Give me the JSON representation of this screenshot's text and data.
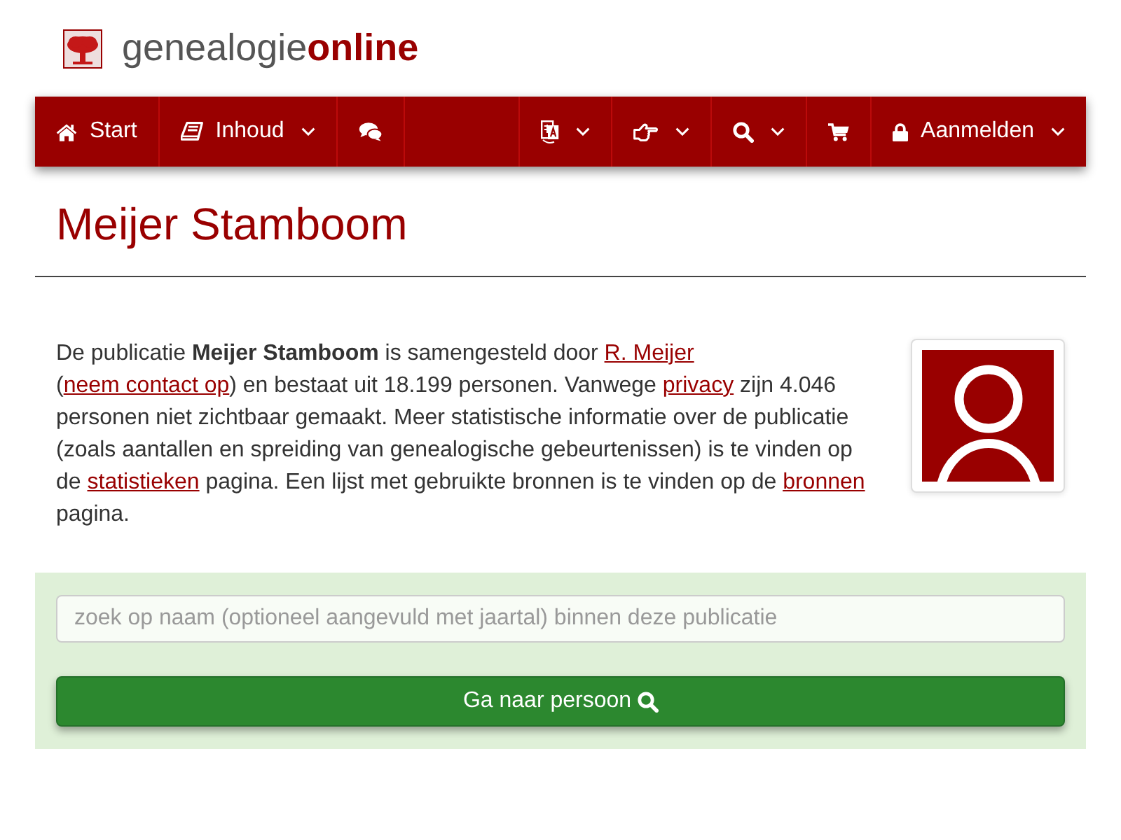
{
  "logo": {
    "name_regular": "genealogie",
    "name_bold": "online"
  },
  "navbar": {
    "left_items": [
      {
        "label": "Start",
        "dropdown": false
      },
      {
        "label": "Inhoud",
        "dropdown": true
      },
      {
        "dropdown": false
      }
    ],
    "right_items": [
      {
        "dropdown": true
      },
      {
        "dropdown": true
      },
      {
        "dropdown": true
      },
      {
        "dropdown": false
      },
      {
        "label": "Aanmelden",
        "dropdown": true
      }
    ]
  },
  "page_title": "Meijer Stamboom",
  "intro": [
    {
      "kind": "text",
      "text": "De publicatie **Meijer Stamboom** is samengesteld door "
    },
    {
      "kind": "link",
      "text": "R. Meijer"
    },
    {
      "kind": "text",
      "text": " ("
    },
    {
      "kind": "link",
      "text": "neem contact op"
    },
    {
      "kind": "text",
      "text": ") en bestaat uit 18.199 personen. Vanwege "
    },
    {
      "kind": "link",
      "text": "privacy"
    },
    {
      "kind": "text",
      "text": " zijn 4.046 personen niet zichtbaar gemaakt. Meer statistische informatie over de publicatie (zoals aantallen en spreiding van genealogische gebeurtenissen) is te vinden op de "
    },
    {
      "kind": "link",
      "text": "statistieken"
    },
    {
      "kind": "text",
      "text": " pagina. Een lijst met gebruikte bronnen is te vinden op de "
    },
    {
      "kind": "link",
      "text": "bronnen"
    },
    {
      "kind": "text",
      "text": " pagina."
    }
  ],
  "search": {
    "placeholder": "zoek op naam (optioneel aangevuld met jaartal) binnen deze publicatie",
    "button": "Ga naar persoon"
  }
}
